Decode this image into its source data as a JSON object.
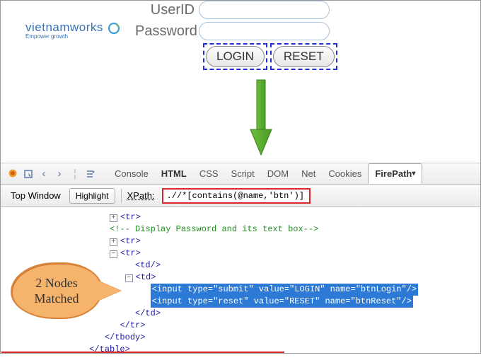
{
  "logo": {
    "main": "vietnamworks",
    "sub": "Empower growth"
  },
  "form": {
    "userid_label": "UserID",
    "password_label": "Password",
    "login_btn": "LOGIN",
    "reset_btn": "RESET"
  },
  "devtools": {
    "tabs": {
      "console": "Console",
      "html": "HTML",
      "css": "CSS",
      "script": "Script",
      "dom": "DOM",
      "net": "Net",
      "cookies": "Cookies",
      "firepath": "FirePath"
    },
    "toolbar": {
      "window_sel": "Top Window",
      "highlight": "Highlight",
      "xpath_label": "XPath:",
      "xpath_value": ".//*[contains(@name,'btn')]"
    },
    "tree": {
      "l1": "<tr>",
      "l2": "<!-- Display Password and its text box-->",
      "l3": "<tr>",
      "l4": "<tr>",
      "l5": "<td/>",
      "l6": "<td>",
      "l7": "<input type=\"submit\" value=\"LOGIN\" name=\"btnLogin\"/>",
      "l8": "<input type=\"reset\" value=\"RESET\" name=\"btnReset\"/>",
      "l9": "</td>",
      "l10": "</tr>",
      "l11": "</tbody>",
      "l12": "</table>"
    }
  },
  "callout": {
    "text": "2 Nodes Matched"
  }
}
